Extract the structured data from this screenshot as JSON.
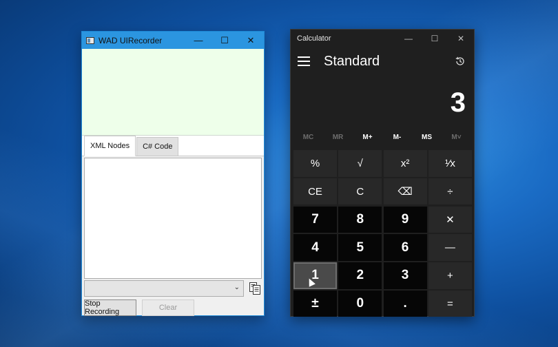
{
  "recorder": {
    "title": "WAD UIRecorder",
    "minimize": "—",
    "maximize": "☐",
    "close": "✕",
    "tabs": [
      {
        "label": "XML Nodes",
        "active": true
      },
      {
        "label": "C# Code",
        "active": false
      }
    ],
    "combo_value": "",
    "combo_chevron": "⌄",
    "stop_label": "Stop Recording",
    "clear_label": "Clear"
  },
  "calculator": {
    "title": "Calculator",
    "minimize": "—",
    "maximize": "☐",
    "close": "✕",
    "mode": "Standard",
    "display": "3",
    "memory": [
      {
        "label": "MC",
        "enabled": false
      },
      {
        "label": "MR",
        "enabled": false
      },
      {
        "label": "M+",
        "enabled": true
      },
      {
        "label": "M-",
        "enabled": true
      },
      {
        "label": "MS",
        "enabled": true
      },
      {
        "label": "M˅",
        "enabled": false
      }
    ],
    "keys": [
      {
        "label": "%",
        "name": "percent-button",
        "kind": "fn"
      },
      {
        "label": "√",
        "name": "square-root-button",
        "kind": "fn"
      },
      {
        "label": "x²",
        "name": "square-button",
        "kind": "fn"
      },
      {
        "label": "¹⁄x",
        "name": "reciprocal-button",
        "kind": "fn"
      },
      {
        "label": "CE",
        "name": "clear-entry-button",
        "kind": "fn"
      },
      {
        "label": "C",
        "name": "clear-button",
        "kind": "fn"
      },
      {
        "label": "⌫",
        "name": "backspace-button",
        "kind": "fn"
      },
      {
        "label": "÷",
        "name": "divide-button",
        "kind": "fn"
      },
      {
        "label": "7",
        "name": "digit-7-button",
        "kind": "num"
      },
      {
        "label": "8",
        "name": "digit-8-button",
        "kind": "num"
      },
      {
        "label": "9",
        "name": "digit-9-button",
        "kind": "num"
      },
      {
        "label": "✕",
        "name": "multiply-button",
        "kind": "fn"
      },
      {
        "label": "4",
        "name": "digit-4-button",
        "kind": "num"
      },
      {
        "label": "5",
        "name": "digit-5-button",
        "kind": "num"
      },
      {
        "label": "6",
        "name": "digit-6-button",
        "kind": "num"
      },
      {
        "label": "—",
        "name": "subtract-button",
        "kind": "fn"
      },
      {
        "label": "1",
        "name": "digit-1-button",
        "kind": "num",
        "hover": true
      },
      {
        "label": "2",
        "name": "digit-2-button",
        "kind": "num"
      },
      {
        "label": "3",
        "name": "digit-3-button",
        "kind": "num"
      },
      {
        "label": "+",
        "name": "add-button",
        "kind": "fn"
      },
      {
        "label": "±",
        "name": "negate-button",
        "kind": "num"
      },
      {
        "label": "0",
        "name": "digit-0-button",
        "kind": "num"
      },
      {
        "label": ".",
        "name": "decimal-button",
        "kind": "num"
      },
      {
        "label": "=",
        "name": "equals-button",
        "kind": "fn"
      }
    ]
  }
}
